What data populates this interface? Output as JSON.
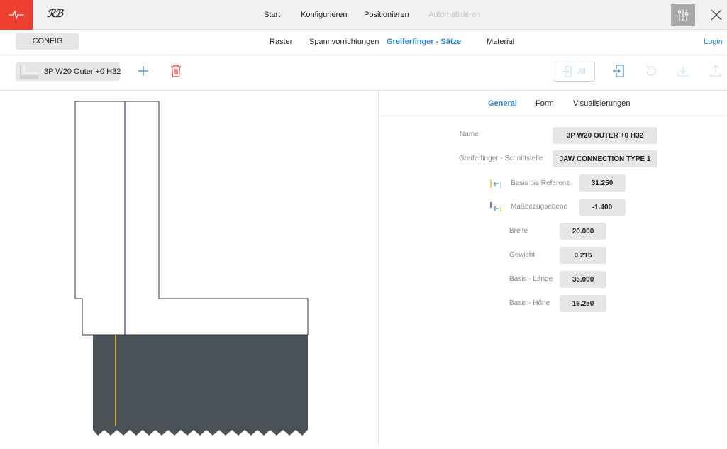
{
  "header": {
    "brand": "ℛℬ",
    "nav": [
      "Start",
      "Konfigurieren",
      "Positionieren",
      "Automatisieren"
    ],
    "disabled_nav": "Automatisieren"
  },
  "subheader": {
    "config_label": "CONFIG",
    "tabs": [
      "Raster",
      "Spannvorrichtungen",
      "Greiferfinger - Sätze",
      "Material"
    ],
    "active_tab": "Greiferfinger - Sätze",
    "login_label": "Login"
  },
  "toolbar": {
    "selected_set": "3P W20 Outer +0 H32",
    "all_label": "All"
  },
  "details": {
    "tabs": [
      "General",
      "Form",
      "Visualisierungen"
    ],
    "active_tab": "General",
    "fields": {
      "name": {
        "label": "Name",
        "value": "3P W20 OUTER +0 H32"
      },
      "interface": {
        "label": "Greiferfinger - Schnittstelle",
        "value": "JAW CONNECTION TYPE 1"
      },
      "base_to_ref": {
        "label": "Basis bis Referenz",
        "value": "31.250"
      },
      "measure_plane": {
        "label": "Maßbezugsebene",
        "value": "-1.400"
      },
      "width": {
        "label": "Breite",
        "value": "20.000"
      },
      "weight": {
        "label": "Gewicht",
        "value": "0.216"
      },
      "base_length": {
        "label": "Basis - Länge",
        "value": "35.000"
      },
      "base_height": {
        "label": "Basis - Höhe",
        "value": "16.250"
      }
    }
  },
  "colors": {
    "accent": "#2a86d6",
    "brand_red": "#ee3e2f",
    "delete_red": "#e0413a",
    "jaw_dark": "#4b5257",
    "ref_yellow": "#f5c211",
    "ref_blue": "#3f3fc8"
  },
  "icons": {
    "logo": "pulse-icon",
    "settings": "sliders-icon",
    "close": "close-icon",
    "add": "plus-icon",
    "delete": "trash-icon",
    "import_all": "import-icon",
    "import": "import-icon",
    "reset": "reset-icon",
    "download": "download-icon",
    "export": "export-icon"
  }
}
